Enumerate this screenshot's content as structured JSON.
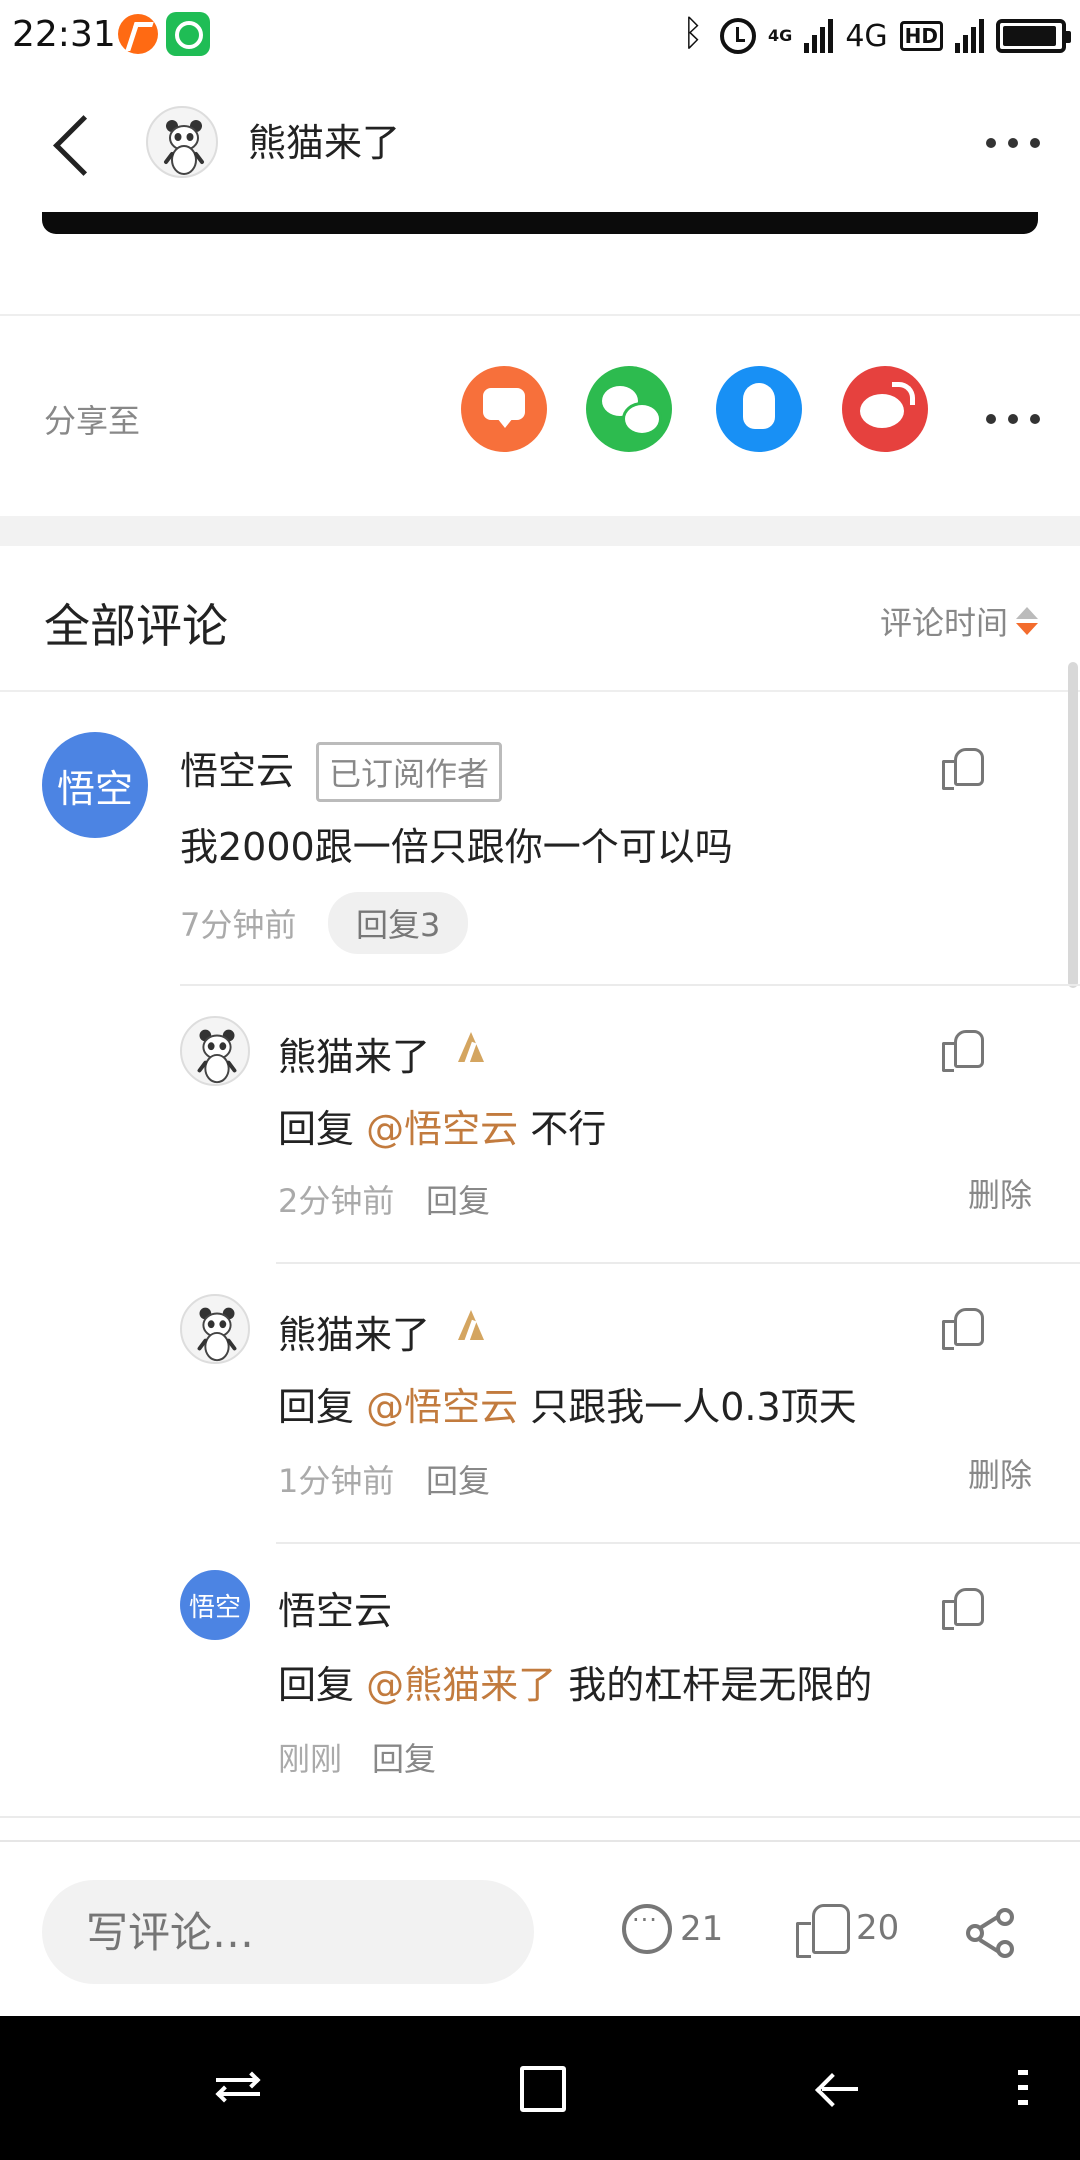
{
  "status_bar": {
    "time": "22:31",
    "network_small": "4G",
    "network": "4G",
    "hd": "HD",
    "battery_level": 0.95
  },
  "header": {
    "title": "熊猫来了"
  },
  "share": {
    "label": "分享至",
    "icons": [
      "message-icon",
      "wechat-icon",
      "qq-icon",
      "weibo-icon",
      "more-icon"
    ]
  },
  "comments_section": {
    "title": "全部评论",
    "sort_label": "评论时间"
  },
  "comments": [
    {
      "avatar_text": "悟空",
      "name": "悟空云",
      "badge": "已订阅作者",
      "content": "我2000跟一倍只跟你一个可以吗",
      "time": "7分钟前",
      "reply_label": "回复3"
    }
  ],
  "replies": [
    {
      "name": "熊猫来了",
      "prefix": "回复",
      "mention": "@悟空云",
      "text": "不行",
      "time": "2分钟前",
      "reply_label": "回复",
      "delete_label": "删除"
    },
    {
      "name": "熊猫来了",
      "prefix": "回复",
      "mention": "@悟空云",
      "text": "只跟我一人0.3顶天",
      "time": "1分钟前",
      "reply_label": "回复",
      "delete_label": "删除"
    },
    {
      "avatar_text": "悟空",
      "name": "悟空云",
      "prefix": "回复",
      "mention": "@熊猫来了",
      "text": "我的杠杆是无限的",
      "time": "刚刚",
      "reply_label": "回复"
    }
  ],
  "bottom_bar": {
    "placeholder": "写评论…",
    "comment_count": "21",
    "like_count": "20"
  },
  "colors": {
    "accent_orange": "#f36c2d",
    "mention": "#c27b3e",
    "avatar_blue": "#4c84e3",
    "rank_gold": "#d4a560"
  }
}
